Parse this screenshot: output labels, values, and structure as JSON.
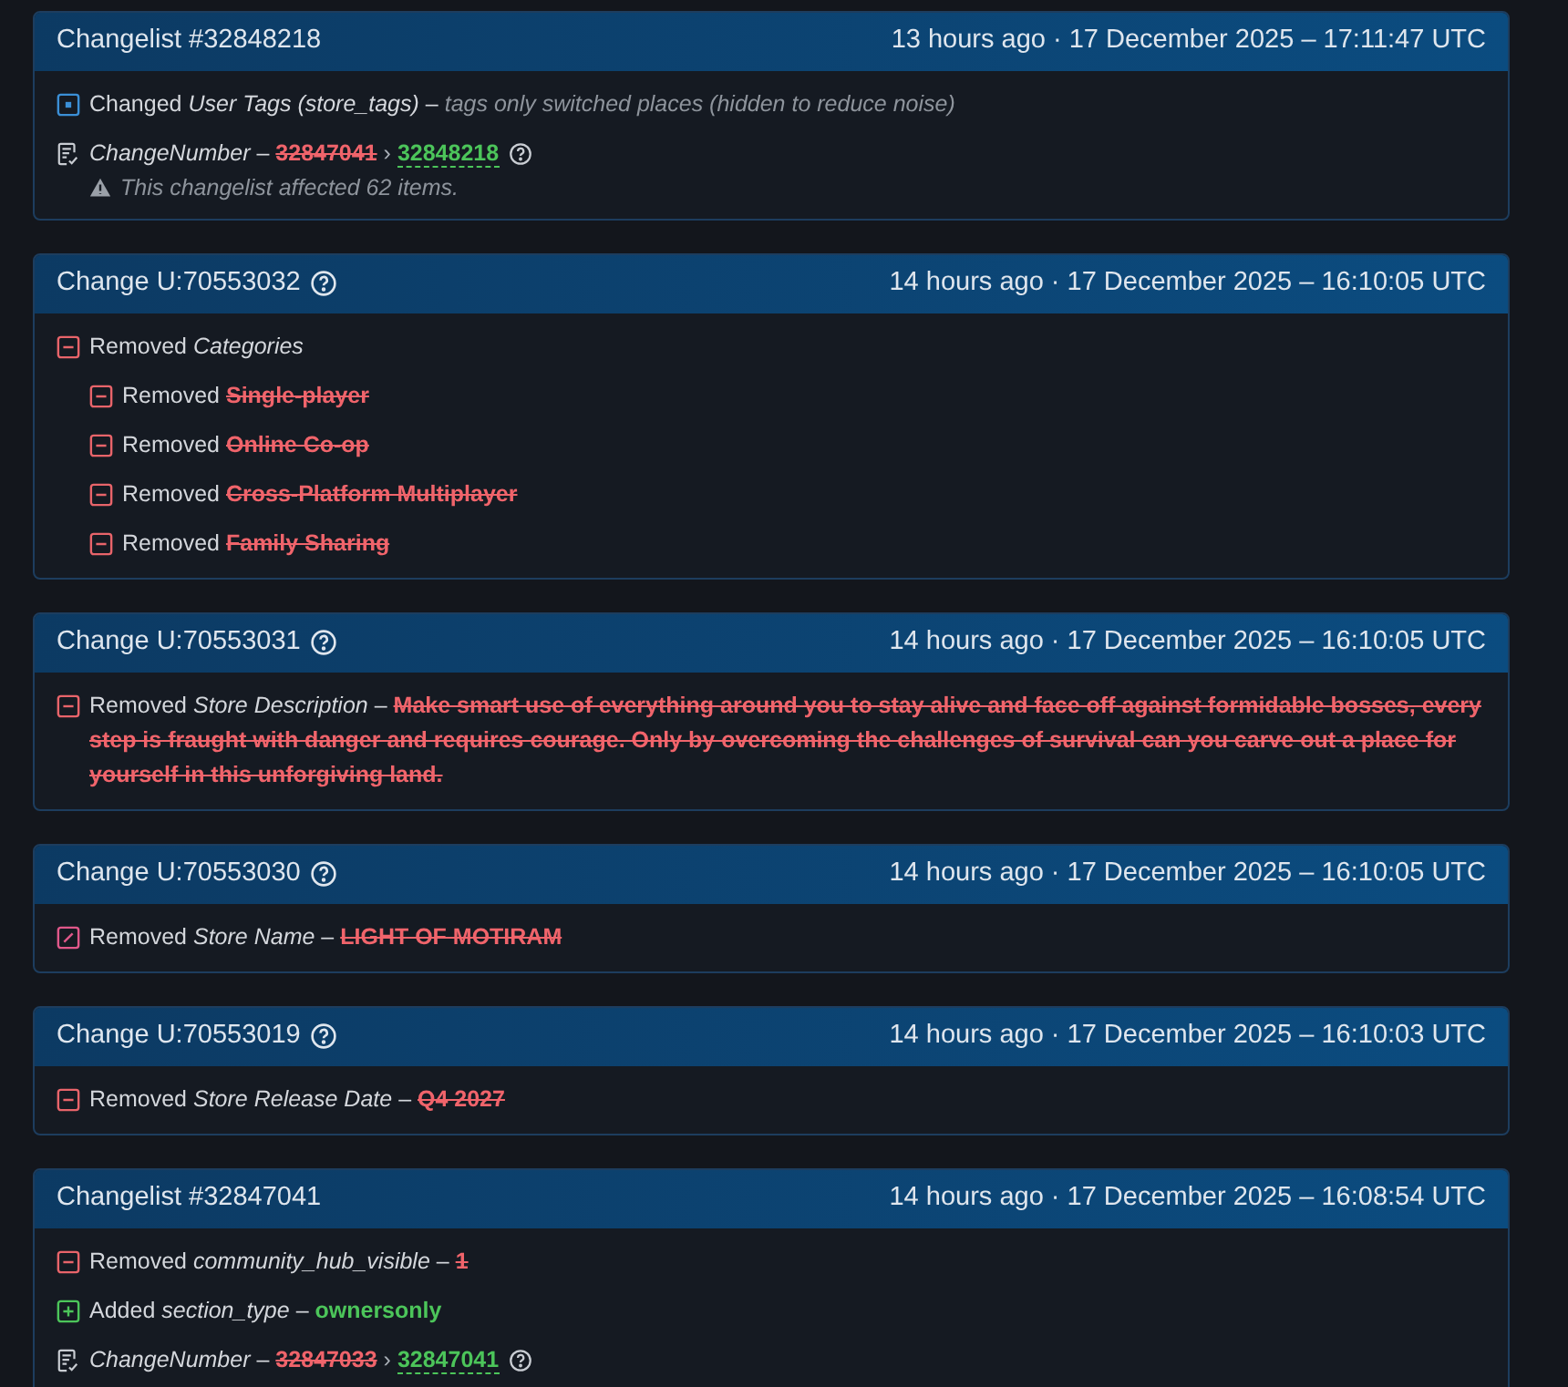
{
  "cards": [
    {
      "title": "Changelist #32848218",
      "help": false,
      "time": "13 hours ago · 17 December 2025 – 17:11:47 UTC",
      "lines": [
        {
          "kind": "changed",
          "verb": "Changed",
          "field": "User Tags (store_tags)",
          "sep": "–",
          "note": "tags only switched places (hidden to reduce noise)"
        },
        {
          "kind": "changenumber",
          "field": "ChangeNumber",
          "sep": "–",
          "old": "32847041",
          "arrow": "›",
          "new": "32848218",
          "help": true,
          "warning": "This changelist affected 62 items."
        }
      ]
    },
    {
      "title": "Change U:70553032",
      "help": true,
      "time": "14 hours ago · 17 December 2025 – 16:10:05 UTC",
      "lines": [
        {
          "kind": "removed",
          "verb": "Removed",
          "field": "Categories",
          "children": [
            {
              "kind": "removed",
              "verb": "Removed",
              "old": "Single-player"
            },
            {
              "kind": "removed",
              "verb": "Removed",
              "old": "Online Co-op"
            },
            {
              "kind": "removed",
              "verb": "Removed",
              "old": "Cross-Platform Multiplayer"
            },
            {
              "kind": "removed",
              "verb": "Removed",
              "old": "Family Sharing"
            }
          ]
        }
      ]
    },
    {
      "title": "Change U:70553031",
      "help": true,
      "time": "14 hours ago · 17 December 2025 – 16:10:05 UTC",
      "lines": [
        {
          "kind": "removed",
          "verb": "Removed",
          "field": "Store Description",
          "sep": "–",
          "old": "Make smart use of everything around you to stay alive and face off against formidable bosses, every step is fraught with danger and requires courage. Only by overcoming the challenges of survival can you carve out a place for yourself in this unforgiving land."
        }
      ]
    },
    {
      "title": "Change U:70553030",
      "help": true,
      "time": "14 hours ago · 17 December 2025 – 16:10:05 UTC",
      "lines": [
        {
          "kind": "edited",
          "verb": "Removed",
          "field": "Store Name",
          "sep": "–",
          "old": "LIGHT OF MOTIRAM"
        }
      ]
    },
    {
      "title": "Change U:70553019",
      "help": true,
      "time": "14 hours ago · 17 December 2025 – 16:10:03 UTC",
      "lines": [
        {
          "kind": "removed",
          "verb": "Removed",
          "field": "Store Release Date",
          "sep": "–",
          "old": "Q4 2027"
        }
      ]
    },
    {
      "title": "Changelist #32847041",
      "help": false,
      "time": "14 hours ago · 17 December 2025 – 16:08:54 UTC",
      "lines": [
        {
          "kind": "removed",
          "verb": "Removed",
          "field": "community_hub_visible",
          "sep": "–",
          "old": "1"
        },
        {
          "kind": "added",
          "verb": "Added",
          "field": "section_type",
          "sep": "–",
          "new": "ownersonly"
        },
        {
          "kind": "changenumber",
          "field": "ChangeNumber",
          "sep": "–",
          "old": "32847033",
          "arrow": "›",
          "new": "32847041",
          "help": true
        }
      ]
    }
  ]
}
